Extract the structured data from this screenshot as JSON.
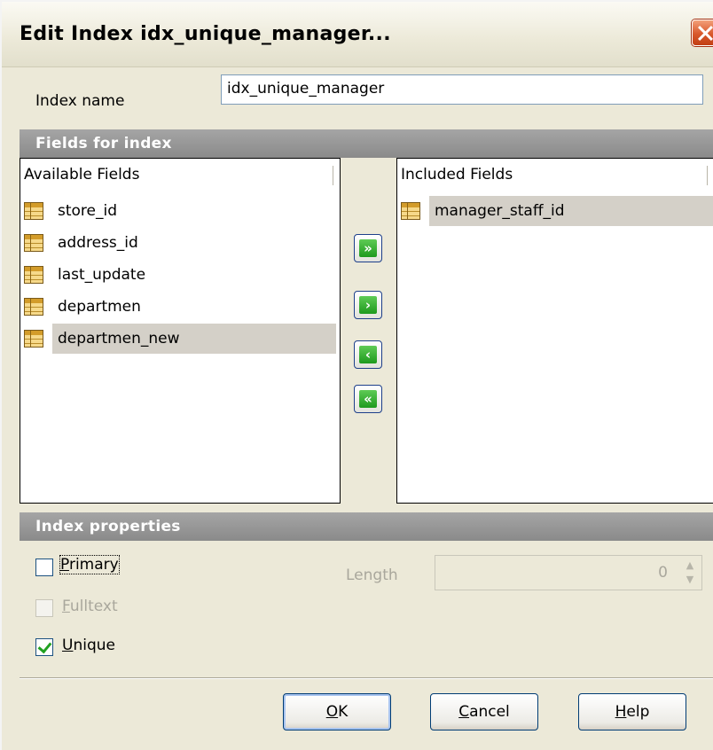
{
  "window": {
    "title": "Edit Index idx_unique_manager..."
  },
  "index_name": {
    "label": "Index name",
    "value": "idx_unique_manager"
  },
  "fields_section": {
    "header": "Fields for index",
    "available": {
      "header": "Available Fields",
      "items": [
        "store_id",
        "address_id",
        "last_update",
        "departmen",
        "departmen_new"
      ],
      "selected": "departmen_new"
    },
    "included": {
      "header": "Included Fields",
      "items": [
        "manager_staff_id"
      ],
      "selected": "manager_staff_id"
    },
    "buttons": {
      "add_all": "»",
      "add_one": "›",
      "remove_one": "‹",
      "remove_all": "«"
    }
  },
  "properties_section": {
    "header": "Index properties",
    "primary": {
      "label_first": "P",
      "label_rest": "rimary",
      "checked": false,
      "enabled": true
    },
    "fulltext": {
      "label_first": "F",
      "label_rest": "ulltext",
      "checked": false,
      "enabled": false
    },
    "unique": {
      "label_first": "U",
      "label_rest": "nique",
      "checked": true,
      "enabled": true
    },
    "length": {
      "label": "Length",
      "value": "0",
      "enabled": false
    }
  },
  "footer": {
    "ok": {
      "first": "O",
      "rest": "K"
    },
    "cancel": {
      "first": "C",
      "rest": "ancel"
    },
    "help": {
      "first": "H",
      "rest": "elp"
    }
  },
  "icons": {
    "field_icon": "table-field-icon",
    "close_icon": "close-icon"
  },
  "colors": {
    "section_header": "#9a9a9a",
    "selection": "#d4d0c8",
    "window_bg": "#ece9d8",
    "close_button": "#d8582b",
    "move_button": "#2aa52a"
  }
}
